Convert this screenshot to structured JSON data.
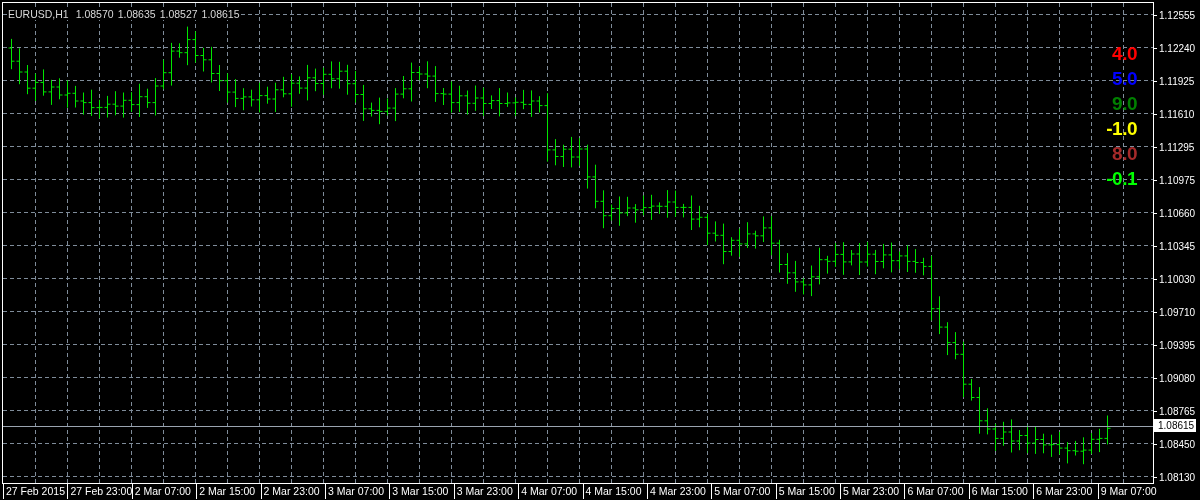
{
  "chart": {
    "symbol": "EURUSD,H1",
    "ohlc": [
      "1.08570",
      "1.08635",
      "1.08527",
      "1.08615"
    ],
    "indicators": [
      {
        "value": "4.0",
        "color": "#ff0000"
      },
      {
        "value": "5.0",
        "color": "#0000ff"
      },
      {
        "value": "9.0",
        "color": "#008000"
      },
      {
        "value": "-1.0",
        "color": "#ffff00"
      },
      {
        "value": "8.0",
        "color": "#a52a2a"
      },
      {
        "value": "-0.1",
        "color": "#00ff00"
      }
    ]
  },
  "price_axis": {
    "labels": [
      "1.12555",
      "1.12240",
      "1.11925",
      "1.11610",
      "1.11295",
      "1.10975",
      "1.10660",
      "1.10345",
      "1.10030",
      "1.09710",
      "1.09395",
      "1.09080",
      "1.08765",
      "1.08450",
      "1.08130"
    ],
    "current_price": "1.08615"
  },
  "time_axis": {
    "labels": [
      "27 Feb 2015",
      "27 Feb 23:00",
      "2 Mar 07:00",
      "2 Mar 15:00",
      "2 Mar 23:00",
      "3 Mar 07:00",
      "3 Mar 15:00",
      "3 Mar 23:00",
      "4 Mar 07:00",
      "4 Mar 15:00",
      "4 Mar 23:00",
      "5 Mar 07:00",
      "5 Mar 15:00",
      "5 Mar 23:00",
      "6 Mar 07:00",
      "6 Mar 15:00",
      "6 Mar 23:00",
      "9 Mar 07:00"
    ]
  }
}
